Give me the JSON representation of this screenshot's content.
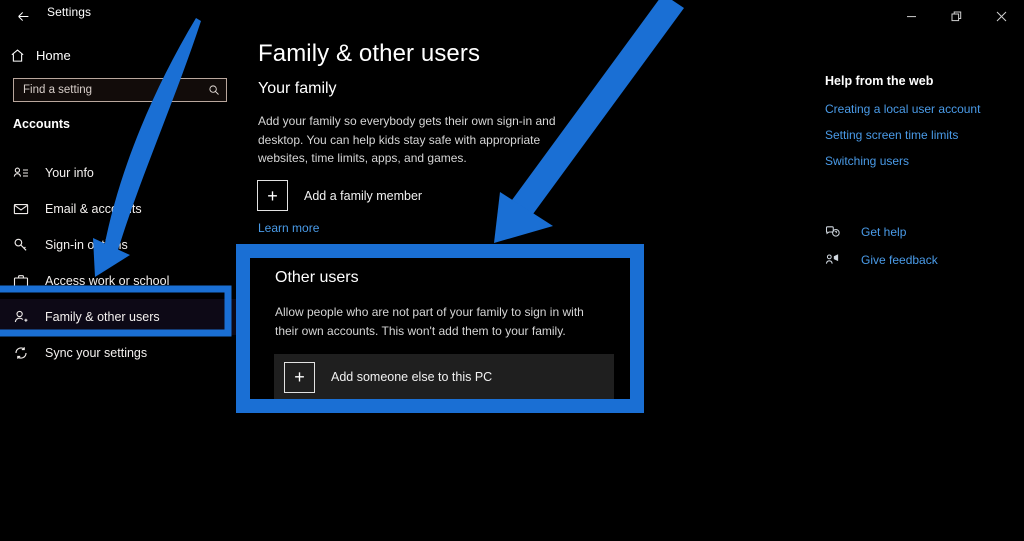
{
  "window": {
    "title": "Settings",
    "back_icon": "back-arrow-icon",
    "controls": [
      {
        "name": "minimize-button",
        "icon": "minimize-icon"
      },
      {
        "name": "restore-button",
        "icon": "restore-icon"
      },
      {
        "name": "close-button",
        "icon": "close-icon"
      }
    ]
  },
  "sidebar": {
    "home_label": "Home",
    "home_icon": "home-icon",
    "search": {
      "placeholder": "Find a setting",
      "value": "",
      "icon": "search-icon"
    },
    "category": "Accounts",
    "items": [
      {
        "label": "Your info",
        "icon": "contact-card-icon",
        "selected": false
      },
      {
        "label": "Email & accounts",
        "icon": "envelope-icon",
        "selected": false
      },
      {
        "label": "Sign-in options",
        "icon": "key-icon",
        "selected": false
      },
      {
        "label": "Access work or school",
        "icon": "briefcase-icon",
        "selected": false
      },
      {
        "label": "Family & other users",
        "icon": "person-add-icon",
        "selected": true
      },
      {
        "label": "Sync your settings",
        "icon": "sync-icon",
        "selected": false
      }
    ]
  },
  "main": {
    "page_title": "Family & other users",
    "family": {
      "heading": "Your family",
      "description": "Add your family so everybody gets their own sign-in and desktop. You can help kids stay safe with appropriate websites, time limits, apps, and games.",
      "add_button_label": "Add a family member",
      "add_button_icon": "plus-icon",
      "learn_more": "Learn more"
    },
    "other_users": {
      "heading": "Other users",
      "description": "Allow people who are not part of your family to sign in with their own accounts. This won't add them to your family.",
      "add_button_label": "Add someone else to this PC",
      "add_button_icon": "plus-icon"
    }
  },
  "help_panel": {
    "heading": "Help from the web",
    "links": [
      "Creating a local user account",
      "Setting screen time limits",
      "Switching users"
    ],
    "actions": [
      {
        "label": "Get help",
        "icon": "help-bubble-icon"
      },
      {
        "label": "Give feedback",
        "icon": "feedback-icon"
      }
    ]
  },
  "annotations": {
    "accent_color": "#1a6fd4",
    "sidebar_highlight": "rectangle around Family & other users",
    "content_highlight": "rectangle around Other users section",
    "arrows": [
      "curved arrow pointing to Family & other users sidebar item",
      "straight arrow pointing to Other users section"
    ]
  }
}
